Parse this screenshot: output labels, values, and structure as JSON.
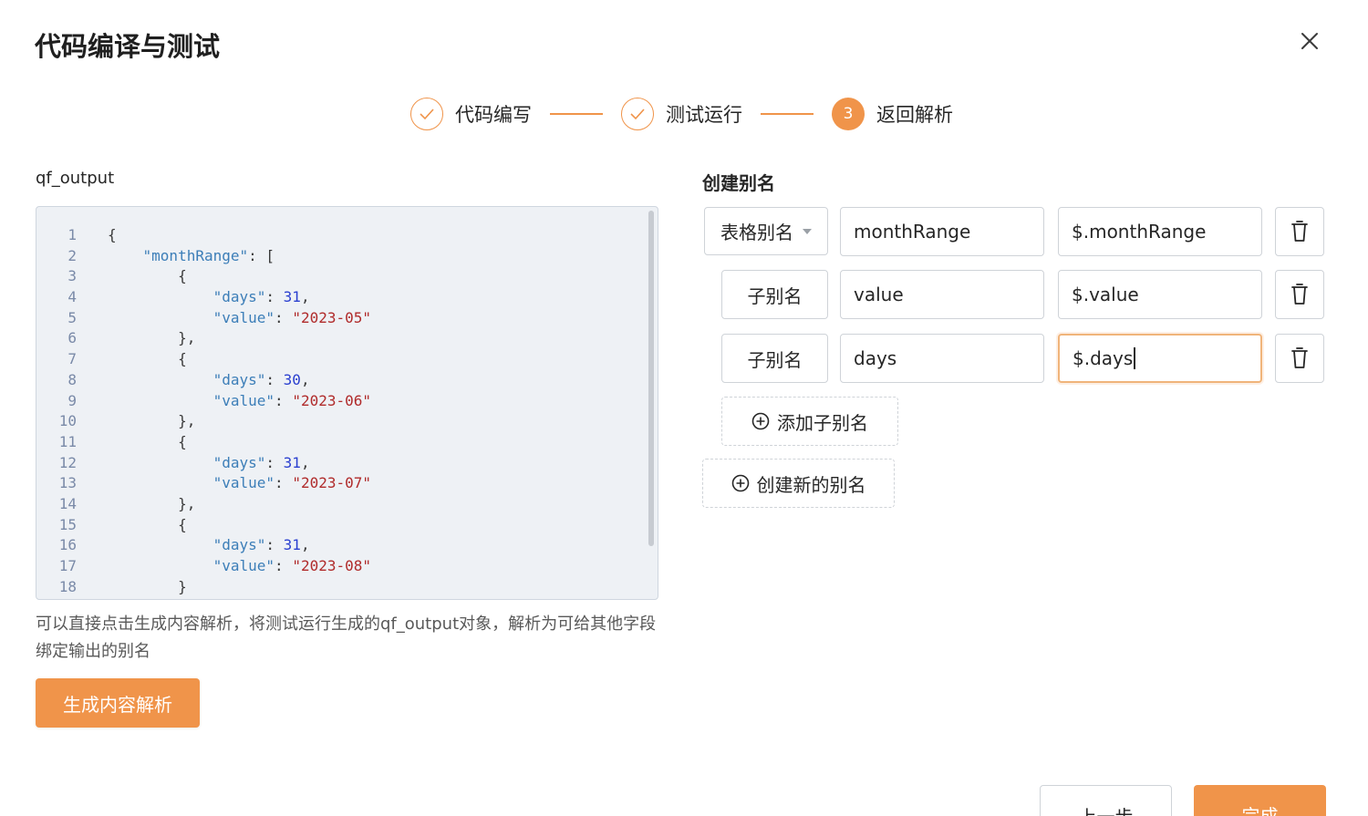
{
  "dialog": {
    "title": "代码编译与测试"
  },
  "steps": [
    {
      "label": "代码编写",
      "status": "done"
    },
    {
      "label": "测试运行",
      "status": "done"
    },
    {
      "number": "3",
      "label": "返回解析",
      "status": "active"
    }
  ],
  "output": {
    "label": "qf_output",
    "code_lines": [
      {
        "n": "1"
      },
      {
        "n": "2"
      },
      {
        "n": "3"
      },
      {
        "n": "4"
      },
      {
        "n": "5"
      },
      {
        "n": "6"
      },
      {
        "n": "7"
      },
      {
        "n": "8"
      },
      {
        "n": "9"
      },
      {
        "n": "10"
      },
      {
        "n": "11"
      },
      {
        "n": "12"
      },
      {
        "n": "13"
      },
      {
        "n": "14"
      },
      {
        "n": "15"
      },
      {
        "n": "16"
      },
      {
        "n": "17"
      },
      {
        "n": "18"
      }
    ],
    "code": {
      "open_brace": "{",
      "month_key": "\"monthRange\"",
      "colon": ":",
      "open_bracket": "[",
      "item_open": "{",
      "item_close": "},",
      "item_close_last": "}",
      "days_key": "\"days\"",
      "value_key": "\"value\"",
      "comma": ",",
      "items": [
        {
          "days": "31",
          "value": "\"2023-05\""
        },
        {
          "days": "30",
          "value": "\"2023-06\""
        },
        {
          "days": "31",
          "value": "\"2023-07\""
        },
        {
          "days": "31",
          "value": "\"2023-08\""
        }
      ]
    },
    "hint": "可以直接点击生成内容解析，将测试运行生成的qf_output对象，解析为可给其他字段绑定输出的别名",
    "generate_button": "生成内容解析"
  },
  "alias": {
    "label": "创建别名",
    "rows": [
      {
        "type": "表格别名",
        "name": "monthRange",
        "path": "$.monthRange"
      },
      {
        "type": "子别名",
        "name": "value",
        "path": "$.value"
      },
      {
        "type": "子别名",
        "name": "days",
        "path": "$.days"
      }
    ],
    "add_child_button": "添加子别名",
    "create_new_button": "创建新的别名"
  },
  "footer": {
    "prev_button": "上一步",
    "finish_button": "完成"
  },
  "colors": {
    "accent": "#f0944a",
    "border": "#cfd3d8",
    "editor_bg": "#eef1f5"
  }
}
